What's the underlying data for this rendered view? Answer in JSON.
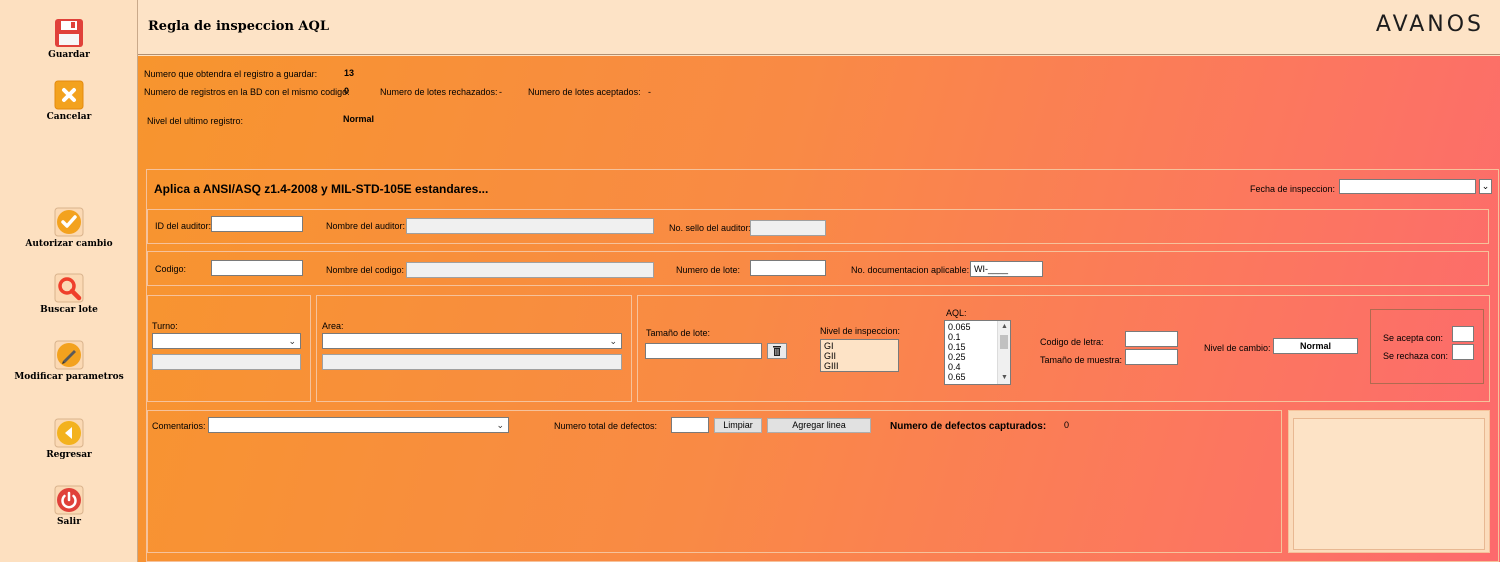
{
  "sidebar": {
    "save_label": "Guardar",
    "cancel_label": "Cancelar",
    "authorize_label": "Autorizar cambio",
    "search_lot_label": "Buscar lote",
    "modify_params_label": "Modificar parametros",
    "back_label": "Regresar",
    "exit_label": "Salir"
  },
  "header": {
    "title": "Regla de inspeccion AQL",
    "brand": "AVANOS"
  },
  "status": {
    "registry_number_label": "Numero que obtendra el registro a guardar:",
    "registry_number_value": "13",
    "db_records_label": "Numero de registros en la BD con el mismo codigo:",
    "db_records_value": "0",
    "rejected_lots_label": "Numero de lotes rechazados:",
    "rejected_lots_value": "-",
    "accepted_lots_label": "Numero de lotes aceptados:",
    "accepted_lots_value": "-",
    "last_level_label": "Nivel del ultimo registro:",
    "last_level_value": "Normal"
  },
  "form": {
    "heading": "Aplica a ANSI/ASQ z1.4-2008 y MIL-STD-105E estandares...",
    "inspection_date_label": "Fecha de inspeccion:",
    "inspection_date_value": "",
    "auditor_id_label": "ID del auditor:",
    "auditor_id_value": "",
    "auditor_name_label": "Nombre del auditor:",
    "auditor_name_value": "",
    "auditor_seal_label": "No. sello del auditor:",
    "auditor_seal_value": "",
    "code_label": "Codigo:",
    "code_value": "",
    "code_name_label": "Nombre del codigo:",
    "code_name_value": "",
    "lot_number_label": "Numero de lote:",
    "lot_number_value": "",
    "doc_label": "No. documentacion aplicable:",
    "doc_value": "WI-____",
    "shift_label": "Turno:",
    "shift_value": "",
    "shift_text_value": "",
    "area_label": "Area:",
    "area_value": "",
    "area_text_value": "",
    "lot_size_label": "Tamaño de lote:",
    "lot_size_value": "",
    "inspection_level_label": "Nivel de inspeccion:",
    "inspection_levels": [
      "GI",
      "GII",
      "GIII"
    ],
    "aql_label": "AQL:",
    "aql_values": [
      "0.065",
      "0.1",
      "0.15",
      "0.25",
      "0.4",
      "0.65"
    ],
    "letter_code_label": "Codigo de letra:",
    "letter_code_value": "",
    "sample_size_label": "Tamaño de muestra:",
    "sample_size_value": "",
    "change_level_label": "Nivel de cambio:",
    "change_level_value": "Normal",
    "accept_label": "Se acepta con:",
    "accept_value": "",
    "reject_label": "Se rechaza con:",
    "reject_value": "",
    "comments_label": "Comentarios:",
    "comments_value": "",
    "total_defects_label": "Numero total de defectos:",
    "total_defects_value": "",
    "clear_label": "Limpiar",
    "add_line_label": "Agregar linea",
    "captured_defects_label": "Numero de defectos capturados:",
    "captured_defects_value": "0"
  },
  "icons": {
    "save": "floppy-disk-icon",
    "cancel": "x-icon",
    "authorize": "checkmark-icon",
    "search": "magnifier-icon",
    "modify": "pencil-icon",
    "back": "left-arrow-icon",
    "exit": "power-icon",
    "trash": "trash-icon"
  },
  "colors": {
    "gradient_start": "#f7952e",
    "gradient_end": "#fd6a6d",
    "panel_bg": "#fde3c6",
    "save_red": "#e0413a",
    "icon_orange": "#f3a21e",
    "exit_red": "#e0413a"
  }
}
